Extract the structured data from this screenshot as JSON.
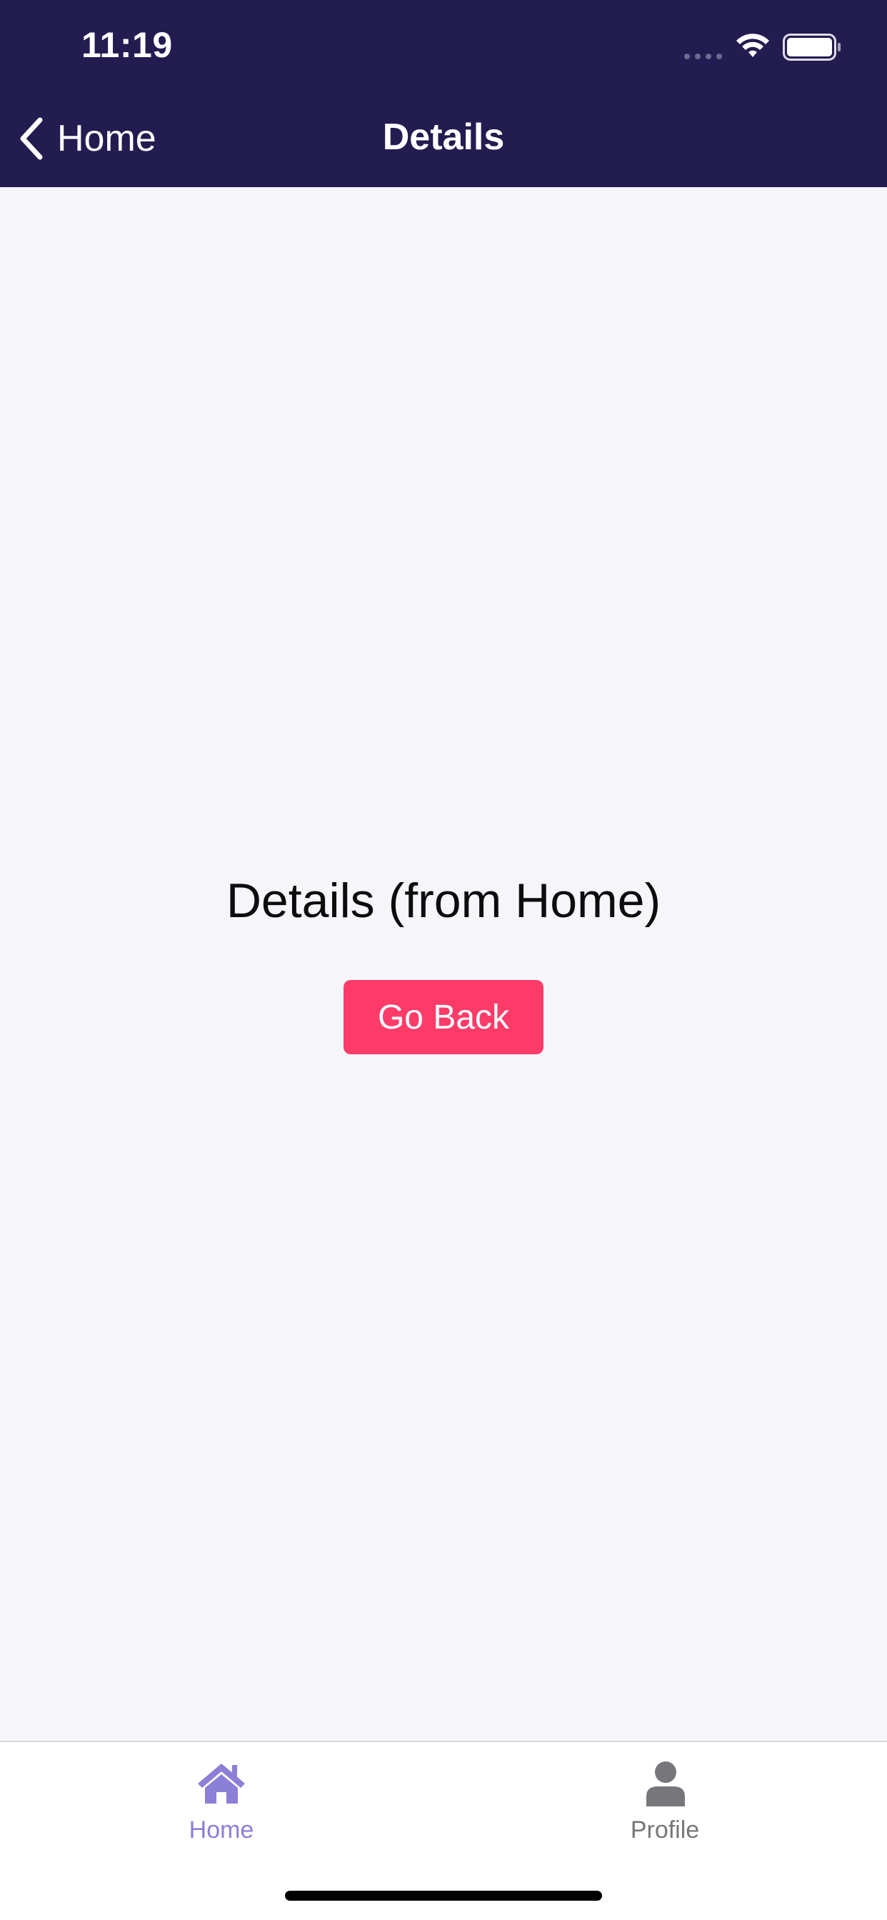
{
  "status_bar": {
    "time": "11:19"
  },
  "nav": {
    "back_label": "Home",
    "title": "Details"
  },
  "content": {
    "title": "Details (from Home)",
    "button_label": "Go Back"
  },
  "tabs": [
    {
      "label": "Home",
      "icon": "home-icon",
      "active": true
    },
    {
      "label": "Profile",
      "icon": "person-icon",
      "active": false
    }
  ],
  "colors": {
    "header_bg": "#221c50",
    "screen_bg": "#f6f5fa",
    "accent_button": "#fd3b69",
    "tab_active": "#8b7fd8",
    "tab_inactive": "#77767a"
  }
}
